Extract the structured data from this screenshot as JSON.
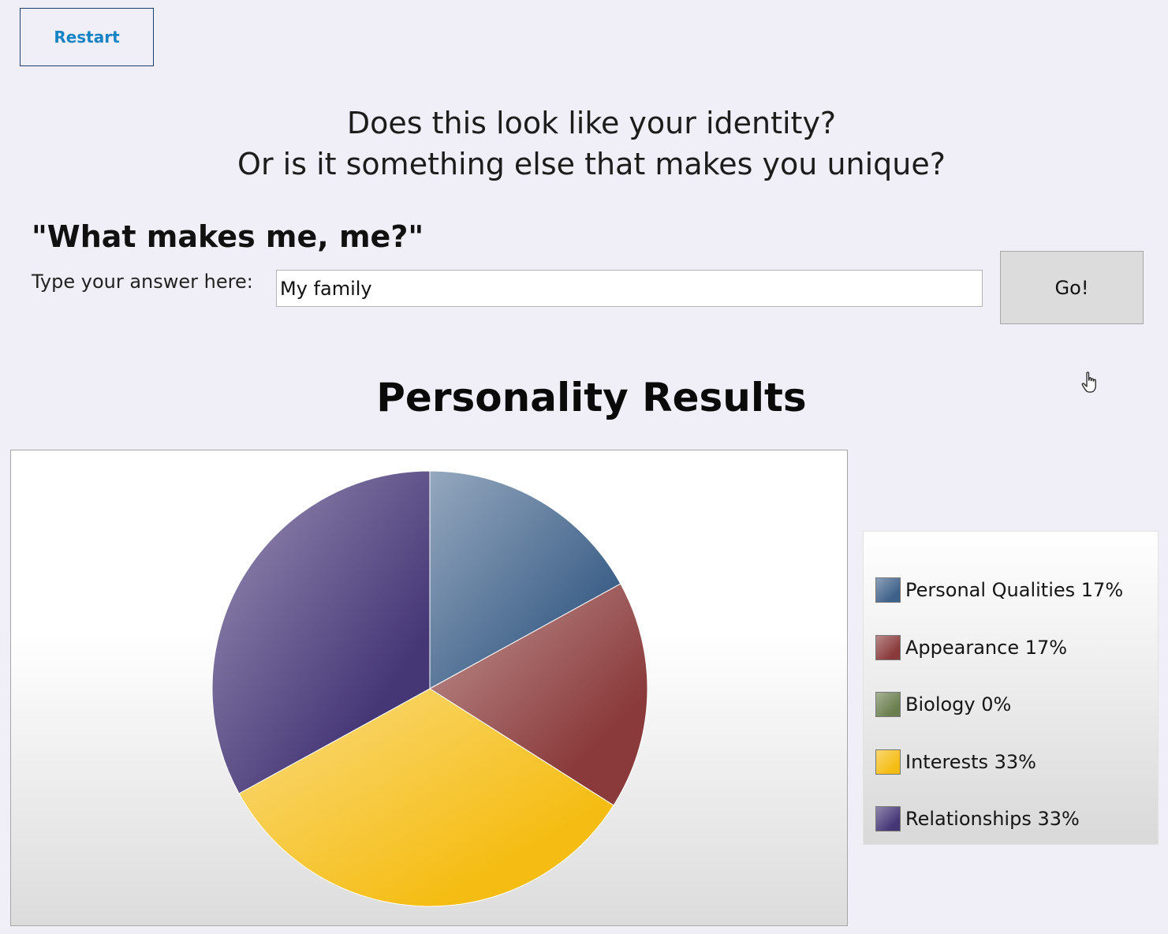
{
  "toolbar": {
    "restart_label": "Restart"
  },
  "question": {
    "line1": "Does this look like your identity?",
    "line2": "Or is it something else that makes you unique?"
  },
  "prompt": {
    "title": "\"What makes me, me?\"",
    "answer_label": "Type your answer here:",
    "answer_value": "My family",
    "go_label": "Go!"
  },
  "chart_data": {
    "type": "pie",
    "title": "Personality Results",
    "legend_position": "right",
    "categories": [
      "Personal Qualities",
      "Appearance",
      "Biology",
      "Interests",
      "Relationships"
    ],
    "values": [
      17,
      17,
      0,
      33,
      33
    ],
    "colors": [
      "#3e6189",
      "#8a3a3a",
      "#6a7f4e",
      "#f5bd14",
      "#453676"
    ],
    "legend": [
      {
        "text": "Personal Qualities  17%"
      },
      {
        "text": "Appearance  17%"
      },
      {
        "text": "Biology 0%"
      },
      {
        "text": "Interests  33%"
      },
      {
        "text": "Relationships  33%"
      }
    ]
  }
}
